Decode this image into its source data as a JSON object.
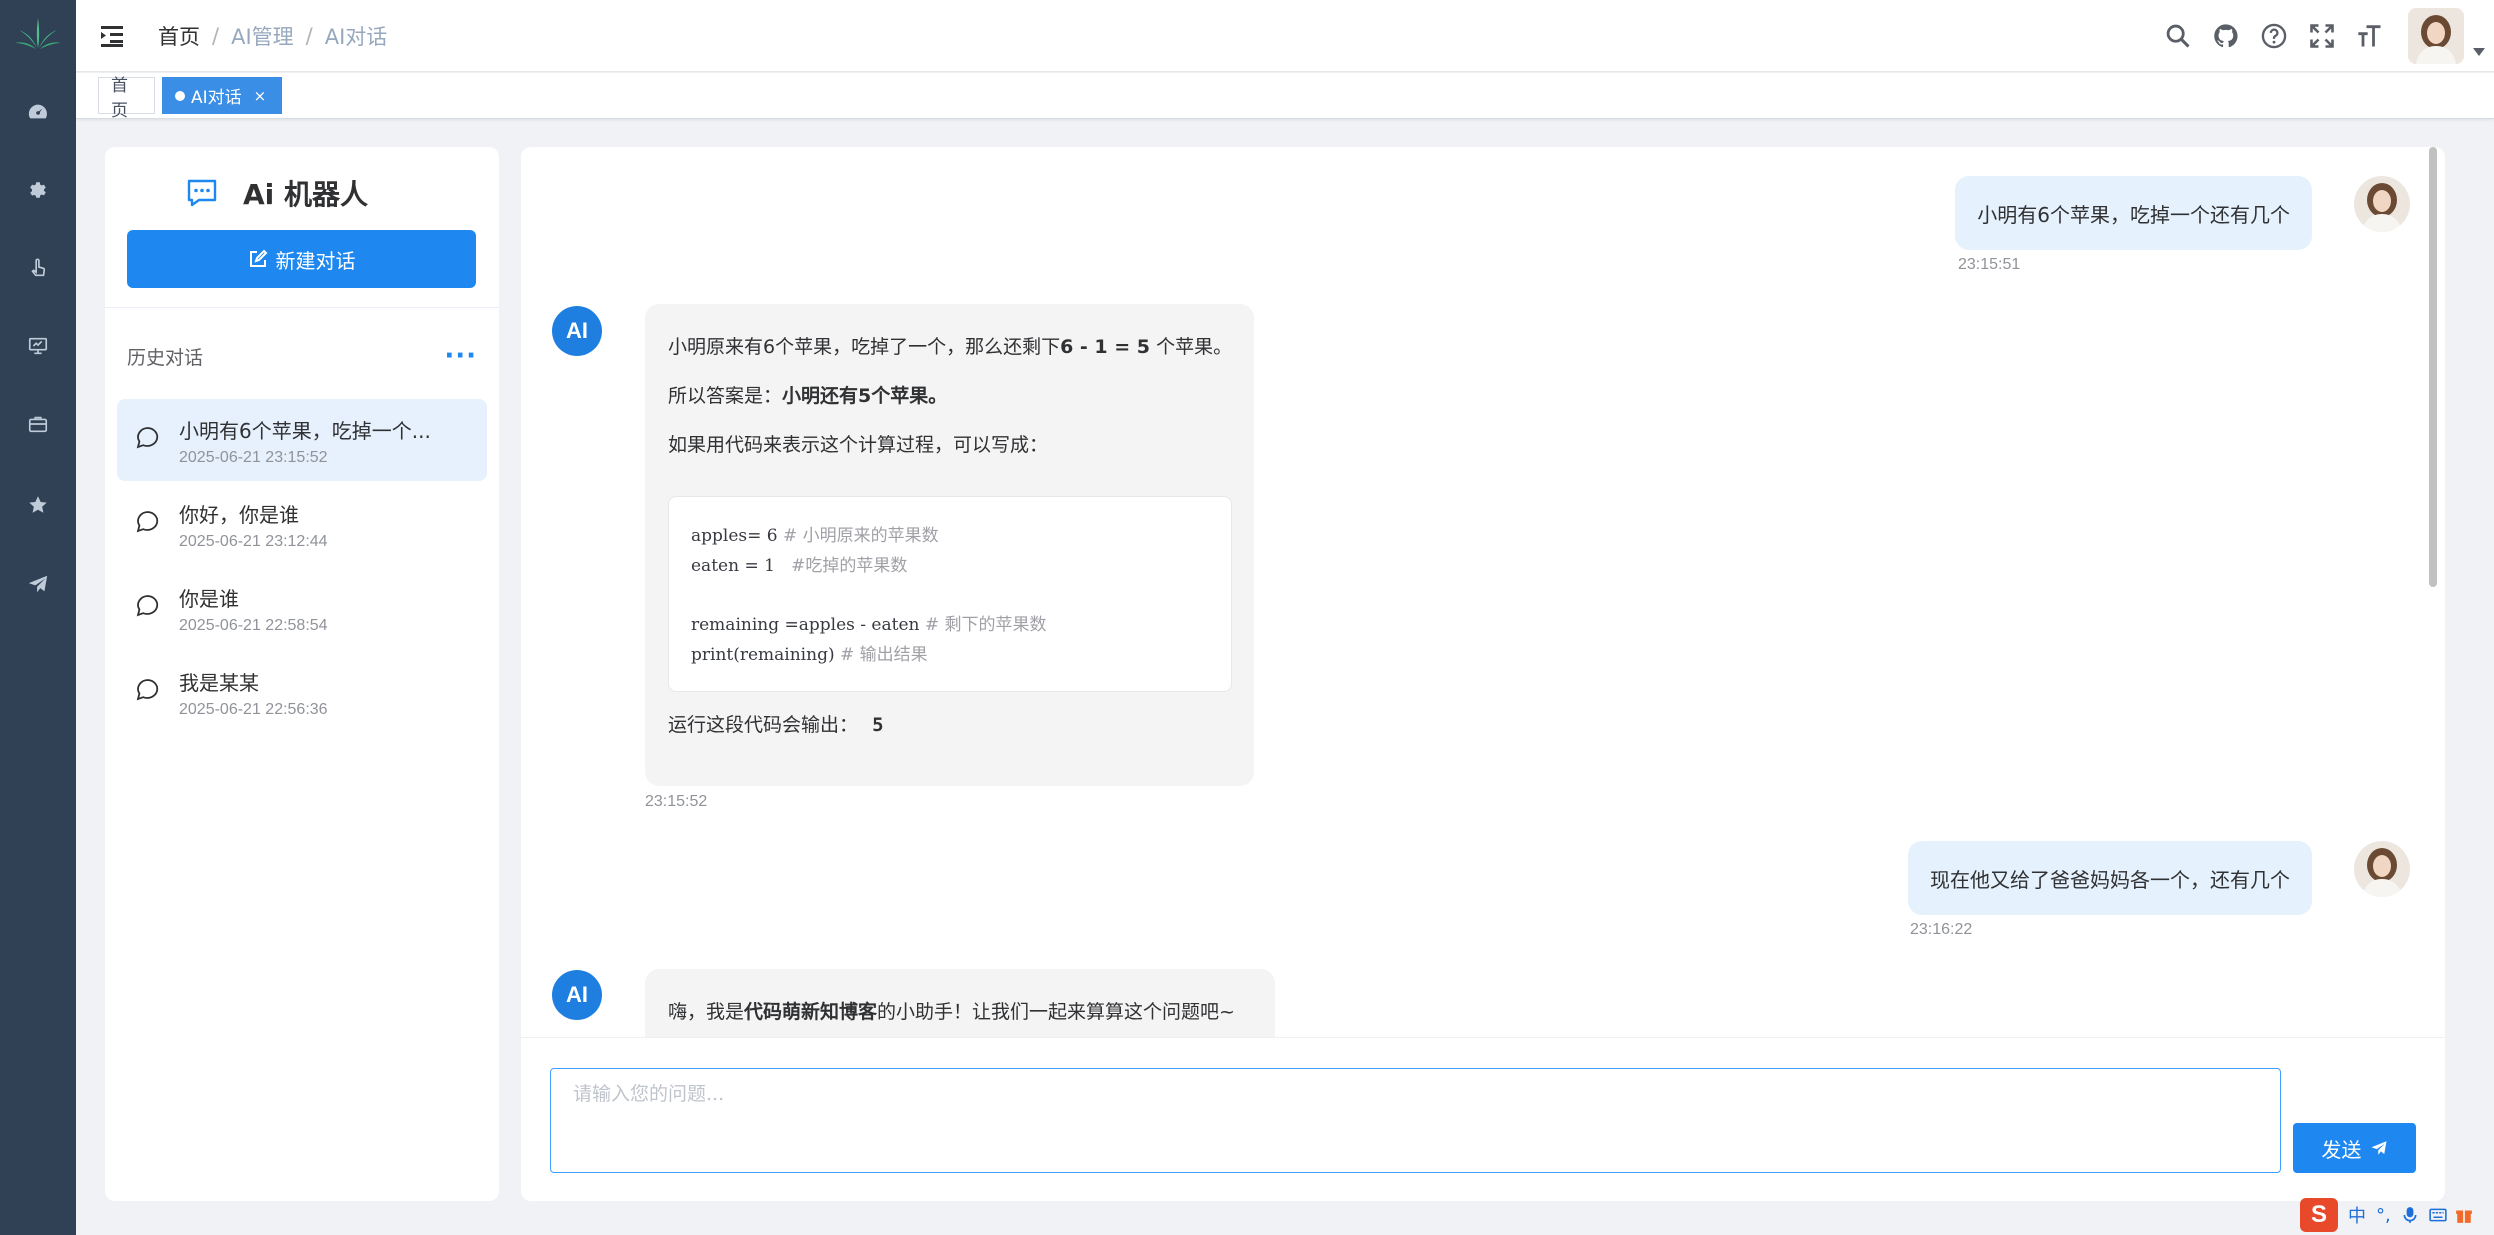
{
  "breadcrumb": [
    "首页",
    "AI管理",
    "AI对话"
  ],
  "tags": {
    "home": "首页",
    "active": "AI对话",
    "close": "×"
  },
  "sidebar": {
    "icons": [
      "dashboard-icon",
      "settings-gear-icon",
      "monitor-hand-icon",
      "monitor-icon",
      "briefcase-icon",
      "star-icon",
      "send-icon"
    ]
  },
  "header": {
    "icons": [
      "search-icon",
      "github-icon",
      "help-icon",
      "fullscreen-icon",
      "font-size-icon"
    ]
  },
  "sessions": {
    "title": "Ai 机器人",
    "new_button": "新建对话",
    "history_label": "历史对话",
    "more": "···",
    "items": [
      {
        "name": "小明有6个苹果，吃掉一个...",
        "time": "2025-06-21 23:15:52"
      },
      {
        "name": "你好，你是谁",
        "time": "2025-06-21 23:12:44"
      },
      {
        "name": "你是谁",
        "time": "2025-06-21 22:58:54"
      },
      {
        "name": "我是某某",
        "time": "2025-06-21 22:56:36"
      }
    ]
  },
  "chat": {
    "ai_avatar": "AI",
    "messages": [
      {
        "role": "user",
        "text": "小明有6个苹果，吃掉一个还有几个",
        "time": "23:15:51"
      },
      {
        "role": "ai",
        "time": "23:15:52",
        "line1_a": "小明原来有6个苹果，吃掉了一个，那么还剩下",
        "line1_b": "6 - 1 = 5",
        "line1_c": " 个苹果。",
        "line2_a": "所以答案是：",
        "line2_b": "小明还有5个苹果。",
        "line3": "如果用代码来表示这个计算过程，可以写成：",
        "code": [
          {
            "code": "apples= 6 ",
            "comment": "# 小明原来的苹果数"
          },
          {
            "code": "eaten = 1   ",
            "comment": "#吃掉的苹果数"
          },
          {
            "code": "remaining =apples - eaten ",
            "comment": "# 剩下的苹果数"
          },
          {
            "code": "print(remaining) ",
            "comment": "# 输出结果"
          }
        ],
        "line4_a": "运行这段代码会输出：",
        "line4_b": "5"
      },
      {
        "role": "user",
        "text": "现在他又给了爸爸妈妈各一个，还有几个",
        "time": "23:16:22"
      },
      {
        "role": "ai",
        "line1_a": "嗨，我是",
        "line1_b": "代码萌新知博客",
        "line1_c": "的小助手！让我们一起来算算这个问题吧~"
      }
    ]
  },
  "input": {
    "placeholder": "请输入您的问题...",
    "value": ""
  },
  "send_button": "发送",
  "ime": {
    "logo": "S",
    "mode": "中"
  },
  "colors": {
    "sidebar": "#304156",
    "primary": "#1e88f0",
    "user_bubble": "#e5f1fd",
    "ai_bubble": "#f4f4f5"
  }
}
